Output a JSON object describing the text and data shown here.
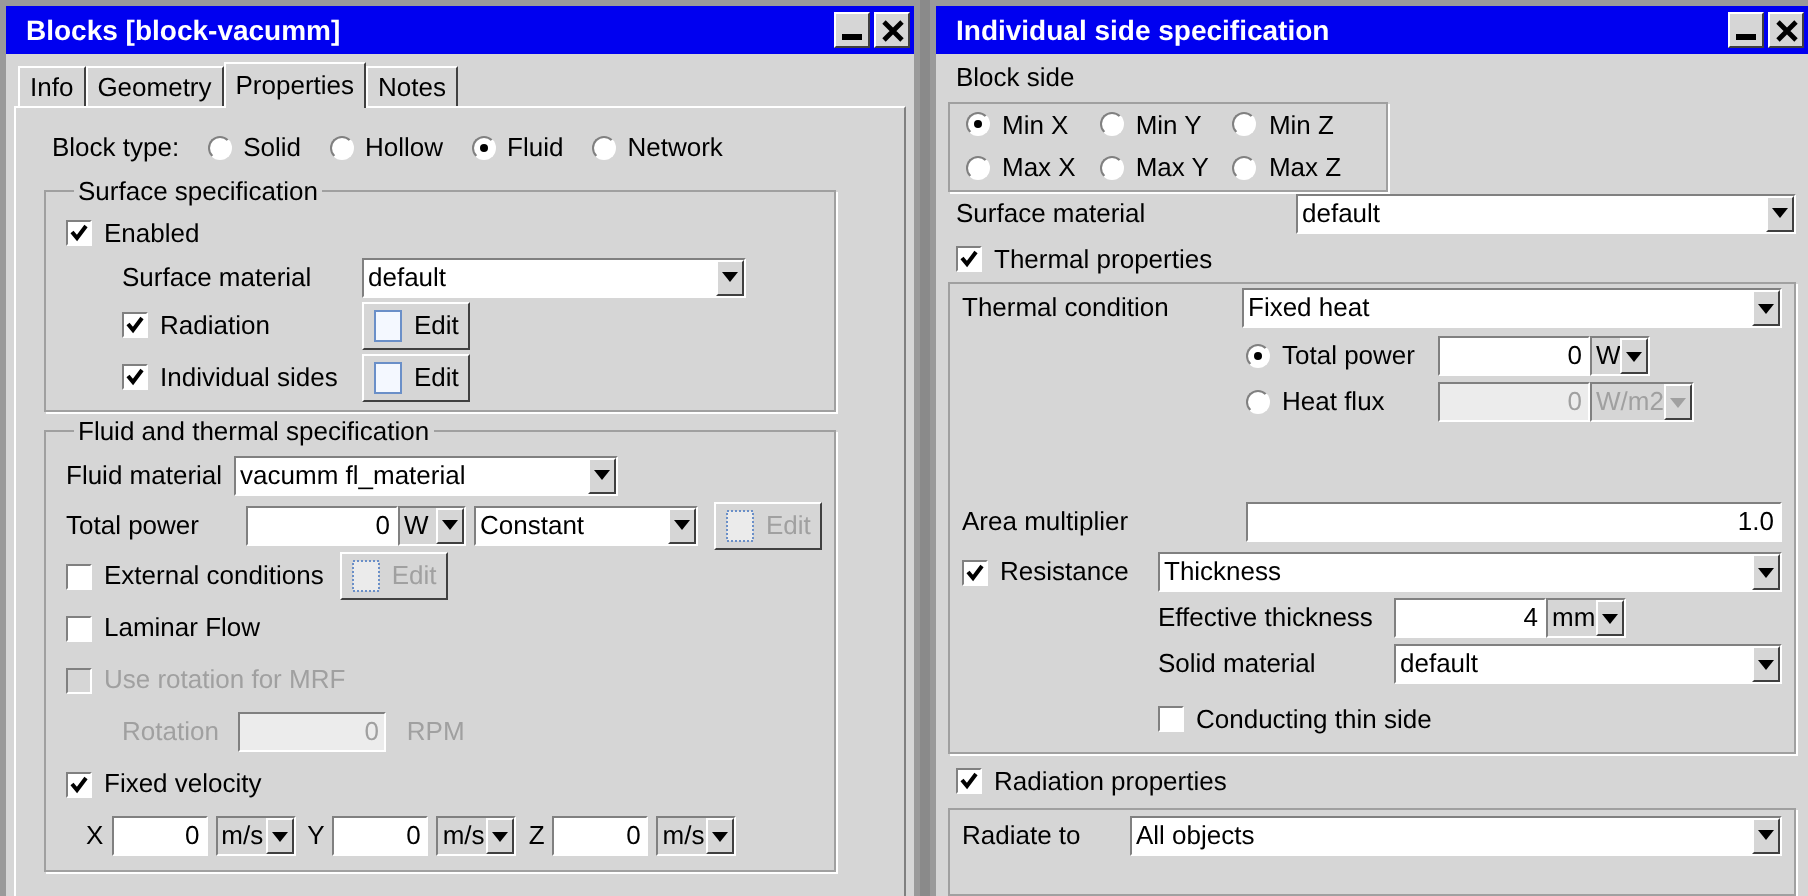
{
  "left_window": {
    "title": "Blocks [block-vacumm]",
    "tabs": [
      {
        "label": "Info",
        "selected": false
      },
      {
        "label": "Geometry",
        "selected": false
      },
      {
        "label": "Properties",
        "selected": true
      },
      {
        "label": "Notes",
        "selected": false
      }
    ],
    "block_type": {
      "label": "Block type:",
      "options": [
        {
          "label": "Solid",
          "selected": false
        },
        {
          "label": "Hollow",
          "selected": false
        },
        {
          "label": "Fluid",
          "selected": true
        },
        {
          "label": "Network",
          "selected": false
        }
      ]
    },
    "surface_spec": {
      "title": "Surface specification",
      "enabled": {
        "label": "Enabled",
        "checked": true
      },
      "surface_material": {
        "label": "Surface material",
        "value": "default"
      },
      "radiation": {
        "label": "Radiation",
        "checked": true,
        "button": {
          "label": "Edit",
          "disabled": false
        }
      },
      "individual_sides": {
        "label": "Individual sides",
        "checked": true,
        "button": {
          "label": "Edit",
          "disabled": false
        }
      }
    },
    "fluid_spec": {
      "title": "Fluid and thermal specification",
      "fluid_material": {
        "label": "Fluid material",
        "value": "vacumm fl_material"
      },
      "total_power": {
        "label": "Total power",
        "value": "0",
        "unit": "W",
        "mode": "Constant",
        "button": {
          "label": "Edit",
          "disabled": true
        }
      },
      "external_conditions": {
        "label": "External conditions",
        "checked": false,
        "button": {
          "label": "Edit",
          "disabled": true
        }
      },
      "laminar_flow": {
        "label": "Laminar Flow",
        "checked": false
      },
      "use_rotation": {
        "label": "Use rotation for MRF",
        "checked": false,
        "disabled": true
      },
      "rotation": {
        "label": "Rotation",
        "value": "0",
        "unit": "RPM",
        "disabled": true
      },
      "fixed_velocity": {
        "label": "Fixed velocity",
        "checked": true
      },
      "velocity": [
        {
          "axis": "X",
          "value": "0",
          "unit": "m/s"
        },
        {
          "axis": "Y",
          "value": "0",
          "unit": "m/s"
        },
        {
          "axis": "Z",
          "value": "0",
          "unit": "m/s"
        }
      ]
    }
  },
  "right_window": {
    "title": "Individual side specification",
    "block_side": {
      "label": "Block side",
      "options": [
        {
          "label": "Min X",
          "selected": true
        },
        {
          "label": "Min Y",
          "selected": false
        },
        {
          "label": "Min Z",
          "selected": false
        },
        {
          "label": "Max X",
          "selected": false
        },
        {
          "label": "Max Y",
          "selected": false
        },
        {
          "label": "Max Z",
          "selected": false
        }
      ]
    },
    "surface_material": {
      "label": "Surface material",
      "value": "default"
    },
    "thermal_properties": {
      "label": "Thermal properties",
      "checked": true
    },
    "thermal_condition": {
      "label": "Thermal condition",
      "value": "Fixed heat"
    },
    "heat_options": [
      {
        "label": "Total power",
        "selected": true,
        "value": "0",
        "unit": "W",
        "disabled": false
      },
      {
        "label": "Heat flux",
        "selected": false,
        "value": "0",
        "unit": "W/m2",
        "disabled": true
      }
    ],
    "area_multiplier": {
      "label": "Area multiplier",
      "value": "1.0"
    },
    "resistance": {
      "label": "Resistance",
      "checked": true,
      "value": "Thickness"
    },
    "effective_thickness": {
      "label": "Effective thickness",
      "value": "4",
      "unit": "mm"
    },
    "solid_material": {
      "label": "Solid material",
      "value": "default"
    },
    "conducting_thin_side": {
      "label": "Conducting thin side",
      "checked": false
    },
    "radiation_properties": {
      "label": "Radiation properties",
      "checked": true
    },
    "radiate_to": {
      "label": "Radiate to",
      "value": "All objects"
    }
  }
}
